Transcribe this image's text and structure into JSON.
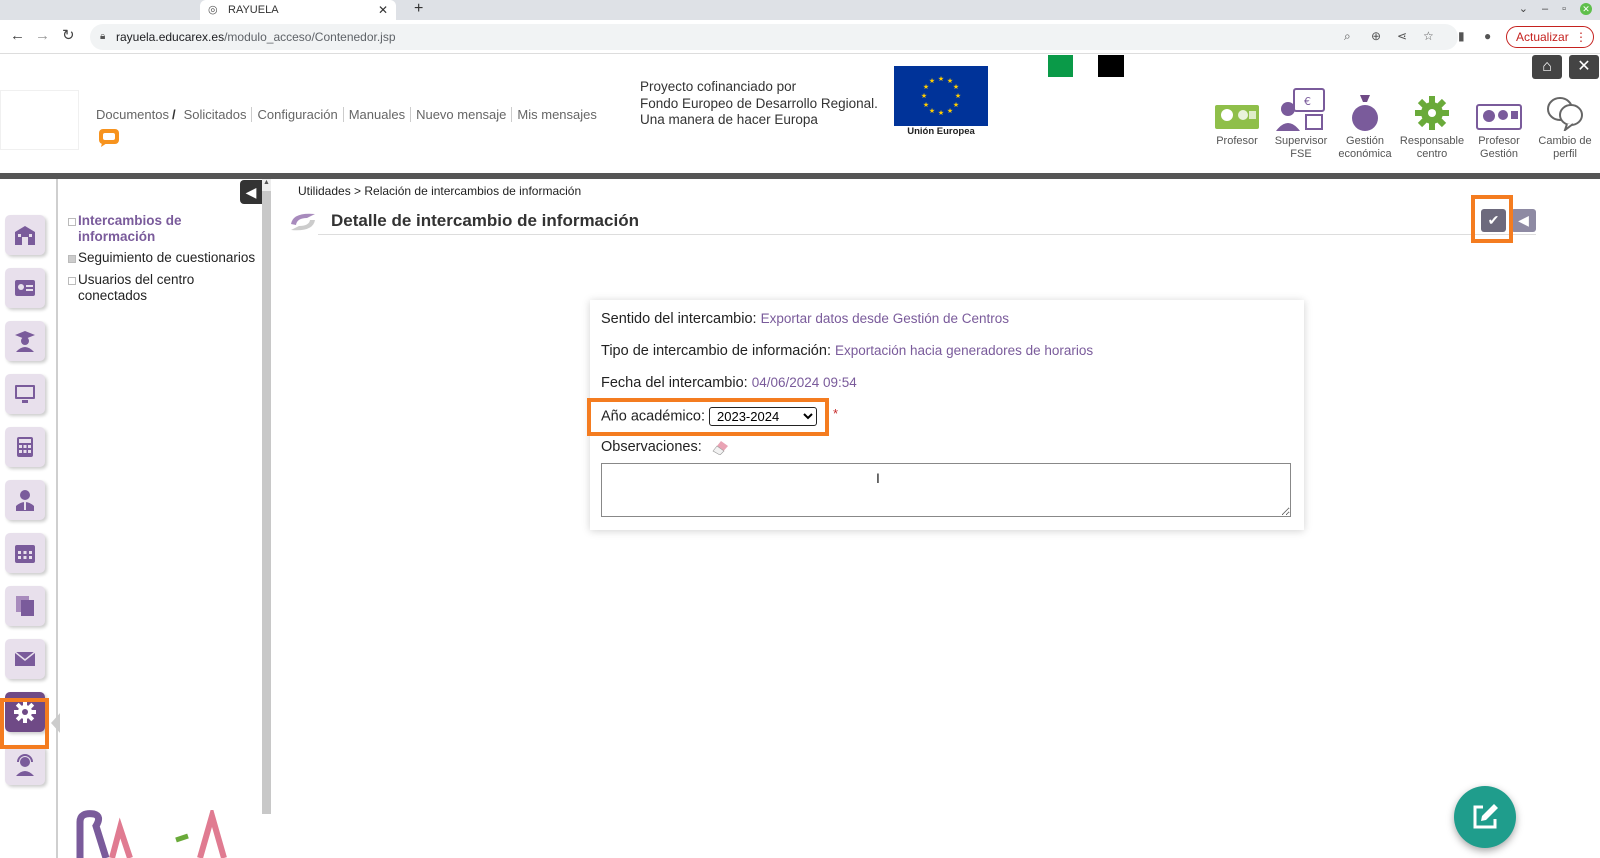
{
  "browser": {
    "tab_title": "RAYUELA",
    "url_host": "rayuela.educarex.es",
    "url_path": "/modulo_acceso/Contenedor.jsp",
    "update_label": "Actualizar"
  },
  "header": {
    "menu": [
      "Documentos",
      "Solicitados",
      "Configuración",
      "Manuales",
      "Nuevo mensaje",
      "Mis mensajes"
    ],
    "eu_text_lines": [
      "Proyecto cofinanciado por",
      "Fondo Europeo de Desarrollo Regional.",
      "Una manera de hacer Europa"
    ],
    "eu_caption": "Unión Europea",
    "profiles": [
      {
        "label": "Profesor",
        "icon": "teacher-icon"
      },
      {
        "label": "Supervisor FSE",
        "icon": "supervisor-icon"
      },
      {
        "label": "Gestión económica",
        "icon": "money-bag-icon"
      },
      {
        "label": "Responsable centro",
        "icon": "gear-icon"
      },
      {
        "label": "Profesor Gestión",
        "icon": "teacher-management-icon"
      },
      {
        "label": "Cambio de perfil",
        "icon": "speech-bubbles-icon"
      }
    ]
  },
  "sidebar": {
    "icons": [
      "school-icon",
      "id-card-icon",
      "student-icon",
      "monitor-icon",
      "calculator-icon",
      "staff-icon",
      "calendar-icon",
      "documents-icon",
      "mail-icon",
      "settings-icon",
      "support-icon"
    ],
    "active_index": 9
  },
  "submenu": {
    "items": [
      {
        "label": "Intercambios de información"
      },
      {
        "label": "Seguimiento de cuestionarios"
      },
      {
        "label": "Usuarios del centro conectados"
      }
    ]
  },
  "main": {
    "breadcrumb": "Utilidades > Relación de intercambios de información",
    "title": "Detalle de intercambio de información",
    "fields": {
      "sentido_label": "Sentido del intercambio:",
      "sentido_value": "Exportar datos desde Gestión de Centros",
      "tipo_label": "Tipo de intercambio de información:",
      "tipo_value": "Exportación hacia generadores de horarios",
      "fecha_label": "Fecha del intercambio:",
      "fecha_value": "04/06/2024 09:54",
      "anio_label": "Año académico:",
      "anio_value": "2023-2024",
      "required_mark": "*",
      "obs_label": "Observaciones:"
    }
  },
  "colors": {
    "accent_purple": "#7a5b9b",
    "highlight_orange": "#f47c20",
    "fab_teal": "#1f9d8c",
    "eu_blue": "#003399"
  }
}
